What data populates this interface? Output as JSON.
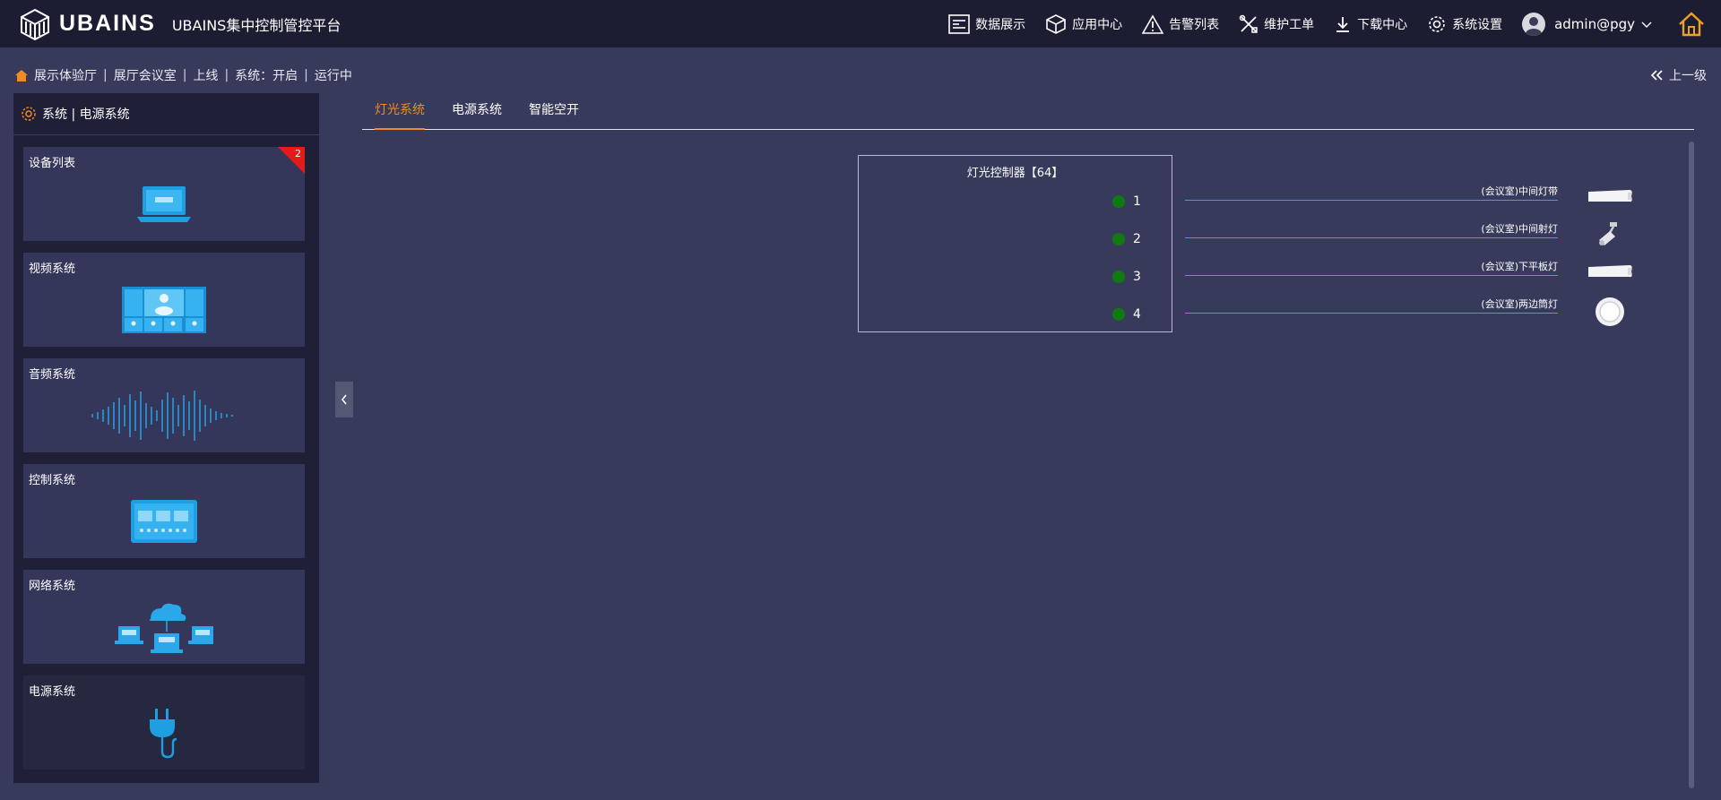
{
  "header": {
    "logo_text": "UBAINS",
    "platform_title": "UBAINS集中控制管控平台",
    "nav": [
      {
        "label": "数据展示",
        "icon": "data-display-icon"
      },
      {
        "label": "应用中心",
        "icon": "cube-icon"
      },
      {
        "label": "告警列表",
        "icon": "warning-icon"
      },
      {
        "label": "维护工单",
        "icon": "tools-icon"
      },
      {
        "label": "下载中心",
        "icon": "download-icon"
      },
      {
        "label": "系统设置",
        "icon": "gear-icon"
      }
    ],
    "user": "admin@pgy"
  },
  "breadcrumb": {
    "items": [
      "展示体验厅",
      "展厅会议室",
      "上线",
      "系统：开启",
      "运行中"
    ],
    "back_label": "上一级"
  },
  "sidebar": {
    "header": "系统 | 电源系统",
    "cards": [
      {
        "label": "设备列表",
        "badge": "2",
        "art": "laptop-icon"
      },
      {
        "label": "视频系统",
        "art": "video-wall-icon"
      },
      {
        "label": "音频系统",
        "art": "sound-wave-icon"
      },
      {
        "label": "控制系统",
        "art": "control-panel-icon"
      },
      {
        "label": "网络系统",
        "art": "network-cloud-icon"
      },
      {
        "label": "电源系统",
        "art": "power-plug-icon"
      }
    ]
  },
  "tabs": [
    {
      "label": "灯光系统",
      "active": true
    },
    {
      "label": "电源系统",
      "active": false
    },
    {
      "label": "智能空开",
      "active": false
    }
  ],
  "controller": {
    "title": "灯光控制器【64】",
    "channels": [
      {
        "number": "1",
        "label": "(会议室)中间灯带",
        "lamp": "light-strip-icon"
      },
      {
        "number": "2",
        "label": "(会议室)中间射灯",
        "lamp": "spotlight-icon"
      },
      {
        "number": "3",
        "label": "(会议室)下平板灯",
        "lamp": "panel-light-icon"
      },
      {
        "number": "4",
        "label": "(会议室)两边筒灯",
        "lamp": "downlight-icon"
      }
    ]
  },
  "colors": {
    "accent": "#f08a24",
    "status_on": "#0f7a0f",
    "line": "#2aa8ea",
    "badge": "#e31b1b"
  }
}
